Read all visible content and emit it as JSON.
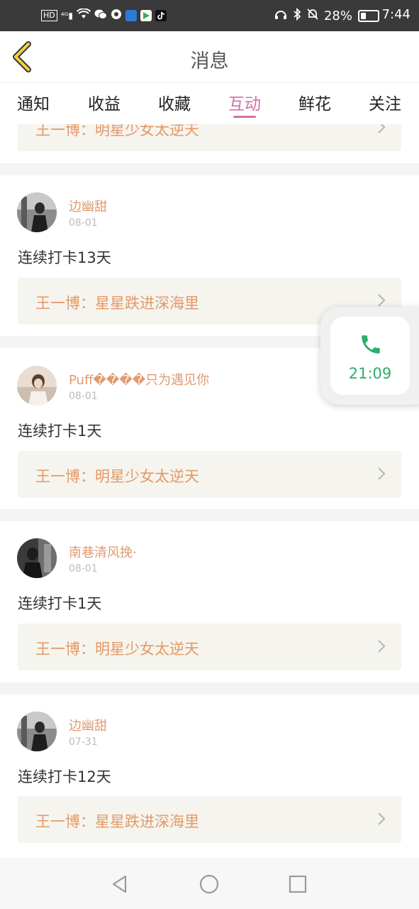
{
  "status_bar": {
    "left_icons": [
      "hd-icon",
      "signal-4g-icon",
      "wifi-icon",
      "wechat-icon",
      "sync-icon",
      "shield-app-icon",
      "play-app-icon",
      "tiktok-icon"
    ],
    "battery_percent": "28%",
    "time": "7:44"
  },
  "header": {
    "title": "消息"
  },
  "tabs": [
    {
      "label": "通知"
    },
    {
      "label": "收益"
    },
    {
      "label": "收藏"
    },
    {
      "label": "互动"
    },
    {
      "label": "鲜花"
    },
    {
      "label": "关注"
    }
  ],
  "active_tab": "互动",
  "top_partial": {
    "link": "王一博：明星少女太逆天"
  },
  "posts": [
    {
      "user": "边幽甜",
      "date": "08-01",
      "text": "连续打卡13天",
      "link": "王一博：星星跌进深海里"
    },
    {
      "user": "Puff����只为遇见你",
      "date": "08-01",
      "text": "连续打卡1天",
      "link": "王一博：明星少女太逆天"
    },
    {
      "user": "南巷清风挽·",
      "date": "08-01",
      "text": "连续打卡1天",
      "link": "王一博：明星少女太逆天"
    },
    {
      "user": "边幽甜",
      "date": "07-31",
      "text": "连续打卡12天",
      "link": "王一博：星星跌进深海里"
    }
  ],
  "call_widget": {
    "time": "21:09"
  },
  "colors": {
    "accent_pink": "#d470a2",
    "username_orange": "#e19a6f",
    "link_orange": "#e59866",
    "call_green": "#2ead6b",
    "card_bg": "#f5f4ee"
  }
}
